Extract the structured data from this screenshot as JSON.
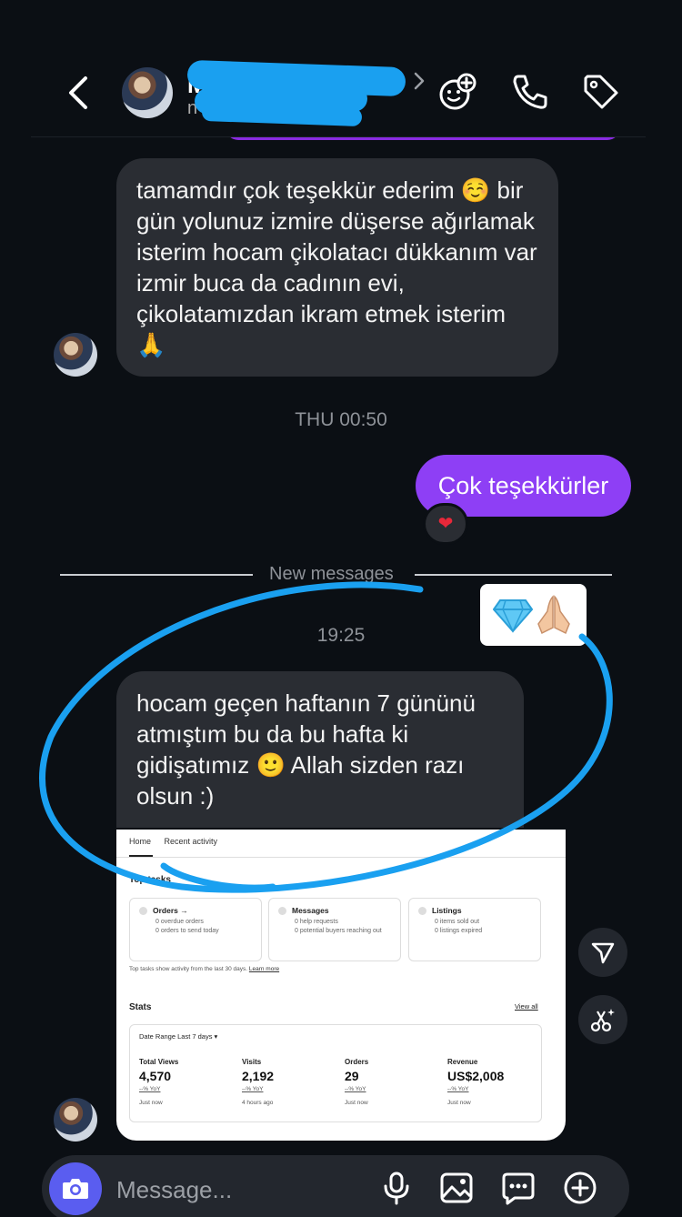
{
  "header": {
    "name": "M",
    "subtitle": "n"
  },
  "messages": {
    "incoming_1": "tamamdır çok teşekkür ederim ☺️ bir gün yolunuz izmire düşerse ağırlamak isterim hocam çikolatacı dükkanım var izmir buca da cadının evi, çikolatamızdan ikram etmek isterim 🙏",
    "timestamp_1": "THU 00:50",
    "outgoing_1": "Çok teşekkürler",
    "reaction_1": "❤",
    "new_messages_label": "New messages",
    "timestamp_2": "19:25",
    "incoming_2": "hocam geçen haftanın 7 gününü atmıştım bu da bu hafta ki gidişatımız 🙂 Allah sizden razı olsun :)"
  },
  "screenshot": {
    "tab_home": "Home",
    "tab_recent": "Recent activity",
    "top_tasks_heading": "Top tasks",
    "tasks": [
      {
        "title": "Orders →",
        "lines": [
          "0 overdue orders",
          "0 orders to send today"
        ]
      },
      {
        "title": "Messages",
        "lines": [
          "0 help requests",
          "0 potential buyers reaching out"
        ]
      },
      {
        "title": "Listings",
        "lines": [
          "0 items sold out",
          "0 listings expired"
        ]
      }
    ],
    "footnote": "Top tasks show activity from the last 30 days.",
    "footnote_link": "Learn more",
    "stats_heading": "Stats",
    "view_all": "View all",
    "date_range": "Date Range Last 7 days ▾",
    "stats": [
      {
        "label": "Total Views",
        "value": "4,570",
        "yoy": "--% YoY",
        "updated": "Just now"
      },
      {
        "label": "Visits",
        "value": "2,192",
        "yoy": "--% YoY",
        "updated": "4 hours ago"
      },
      {
        "label": "Orders",
        "value": "29",
        "yoy": "--% YoY",
        "updated": "Just now"
      },
      {
        "label": "Revenue",
        "value": "US$2,008",
        "yoy": "--% YoY",
        "updated": "Just now"
      }
    ]
  },
  "composer": {
    "placeholder": "Message..."
  },
  "colors": {
    "background": "#0b0f14",
    "incoming_bubble": "#2a2d33",
    "outgoing_bubble": "#8e3ff5",
    "annotation": "#1aa0f0",
    "camera_button": "#5a5df0"
  }
}
